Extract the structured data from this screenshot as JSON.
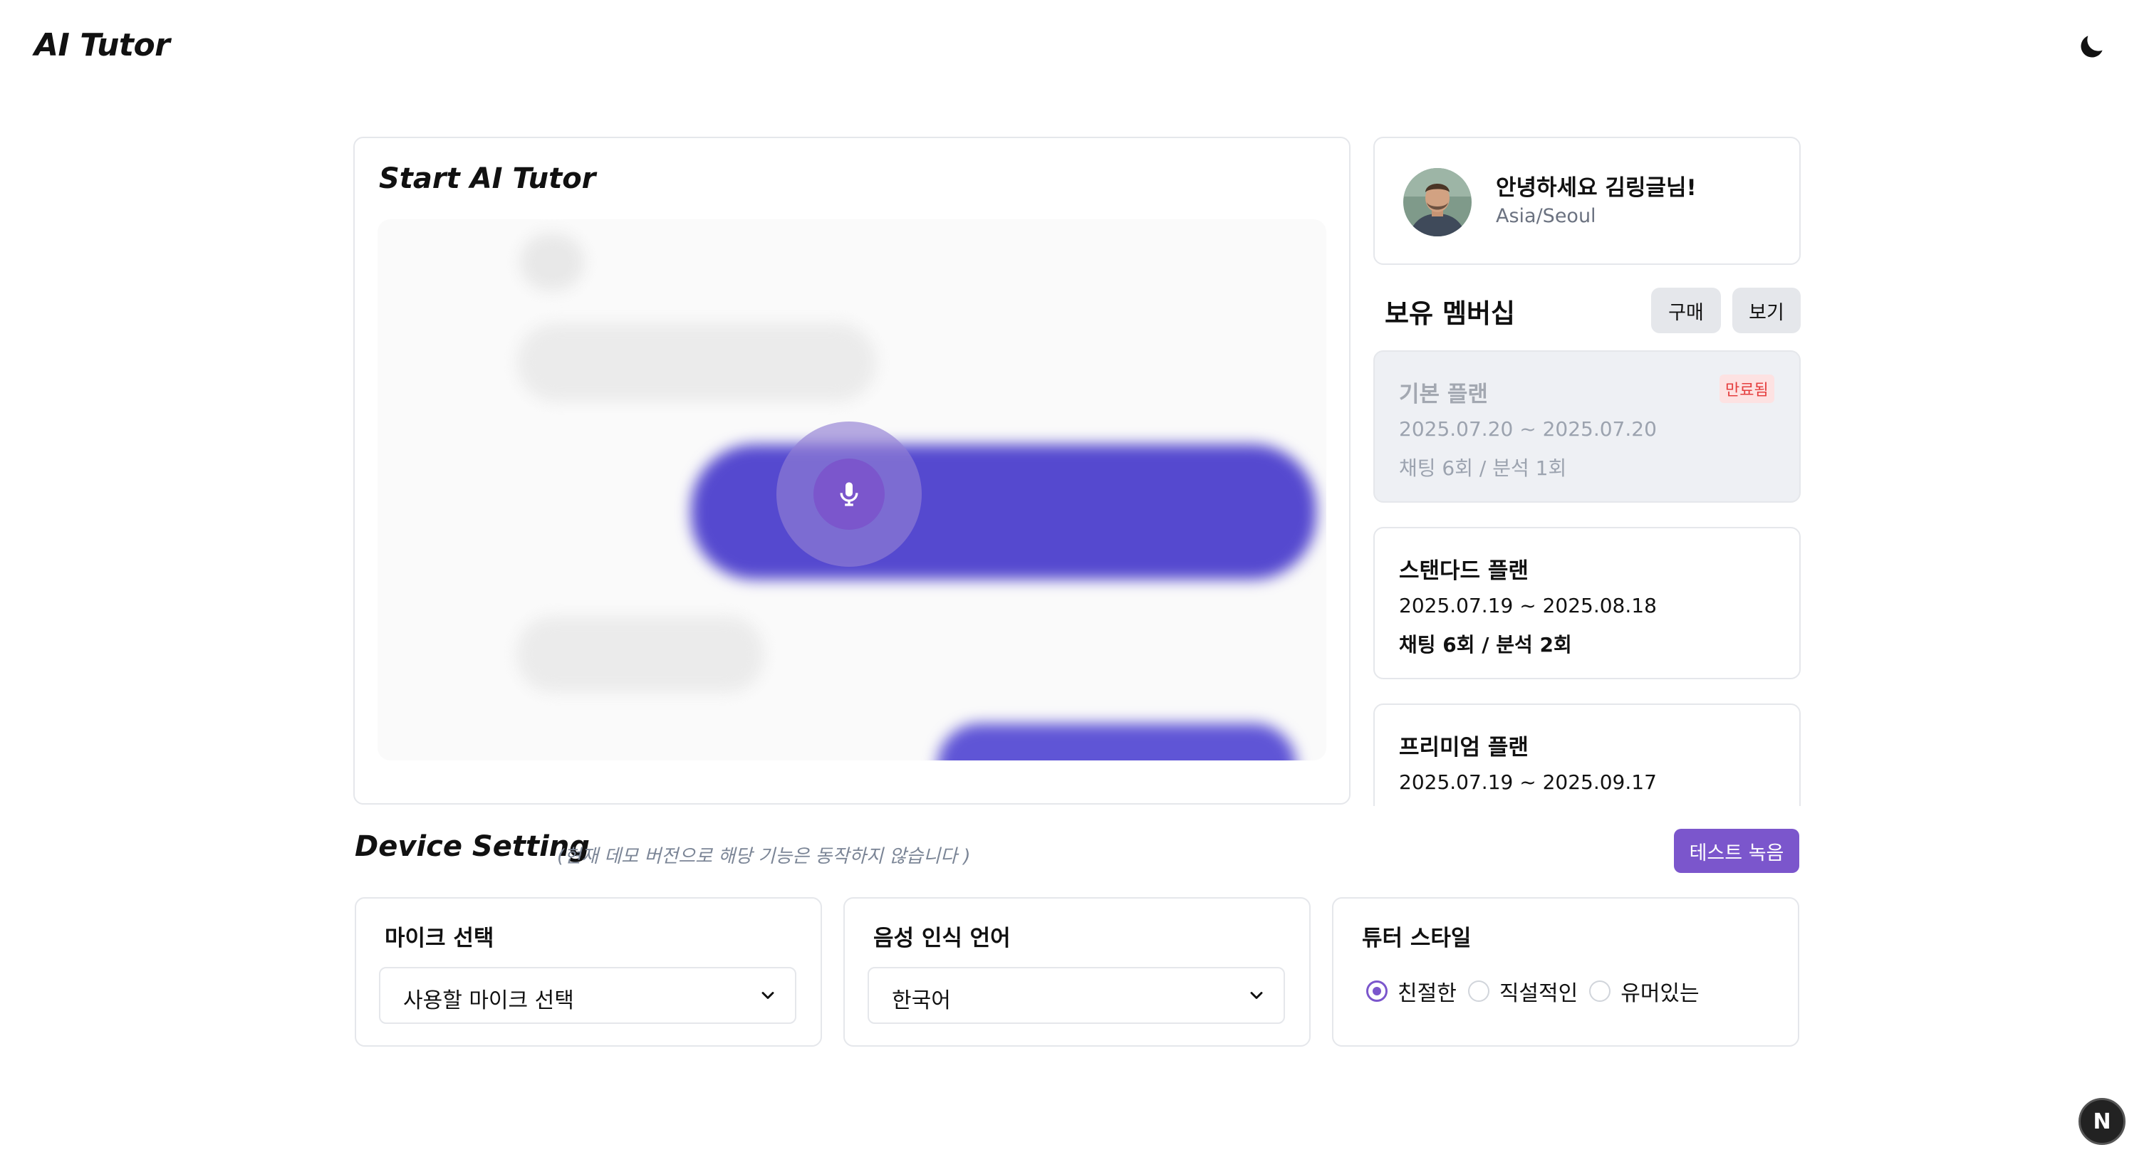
{
  "app": {
    "title": "AI Tutor"
  },
  "header": {
    "theme_toggle_icon": "moon-icon"
  },
  "tutor": {
    "title": "Start AI Tutor",
    "mic_icon": "microphone-icon"
  },
  "profile": {
    "greeting": "안녕하세요 김링글님!",
    "timezone": "Asia/Seoul"
  },
  "membership": {
    "title": "보유 멤버십",
    "buy_label": "구매",
    "view_label": "보기",
    "plans": [
      {
        "name": "기본 플랜",
        "dates": "2025.07.20 ~ 2025.07.20",
        "usage": "채팅 6회 / 분석 1회",
        "badge": "만료됨"
      },
      {
        "name": "스탠다드 플랜",
        "dates": "2025.07.19 ~ 2025.08.18",
        "usage": "채팅 6회 / 분석 2회"
      },
      {
        "name": "프리미엄 플랜",
        "dates": "2025.07.19 ~ 2025.09.17"
      }
    ]
  },
  "device": {
    "title": "Device Setting",
    "note": "(현재 데모 버전으로 해당 기능은 동작하지 않습니다 )",
    "test_record_label": "테스트 녹음",
    "mic": {
      "label": "마이크 선택",
      "value": "사용할 마이크 선택"
    },
    "language": {
      "label": "음성 인식 언어",
      "value": "한국어"
    },
    "style": {
      "label": "튜터 스타일",
      "options": [
        "친절한",
        "직설적인",
        "유머있는"
      ],
      "selected": "친절한"
    }
  },
  "corner_badge": "N",
  "colors": {
    "accent": "#7b56cc",
    "chat_blue": "#5549cf",
    "expired_red": "#e53e3e"
  }
}
